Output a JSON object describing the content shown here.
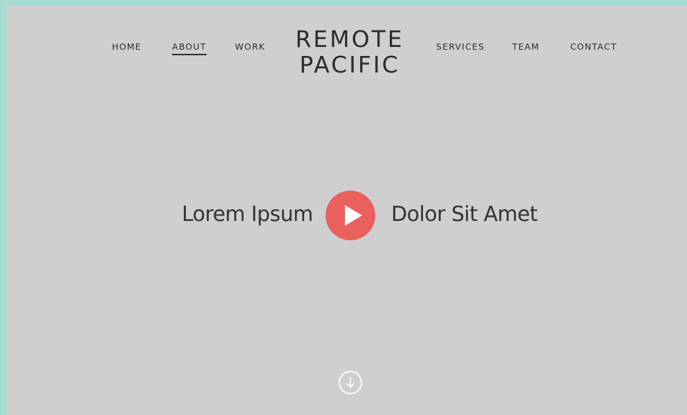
{
  "nav": {
    "items": [
      {
        "label": "HOME",
        "active": false
      },
      {
        "label": "ABOUT",
        "active": true
      },
      {
        "label": "WORK",
        "active": false
      },
      {
        "label": "SERVICES",
        "active": false
      },
      {
        "label": "TEAM",
        "active": false
      },
      {
        "label": "CONTACT",
        "active": false
      }
    ]
  },
  "logo": {
    "line1": "REMOTE",
    "line2": "PACIFIC"
  },
  "hero": {
    "left_text": "Lorem Ipsum",
    "right_text": "Dolor Sit Amet",
    "play_icon": "play-icon"
  },
  "scroll": {
    "icon": "arrow-down-circle-icon"
  },
  "colors": {
    "frame": "#a5ddd3",
    "background": "#cfcfcf",
    "accent": "#e9605e",
    "text": "#2b2b2b"
  }
}
